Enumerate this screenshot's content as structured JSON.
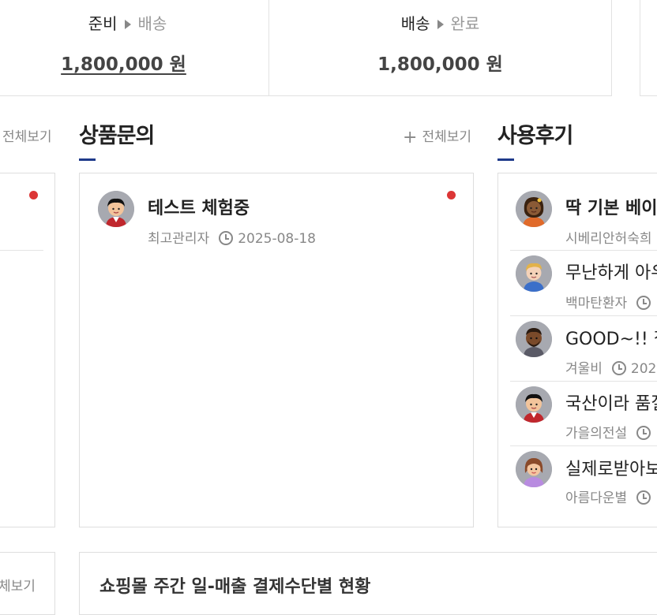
{
  "stats": [
    {
      "from": "준비",
      "to": "배송",
      "value": "1,800,000 원"
    },
    {
      "from": "배송",
      "to": "완료",
      "value": "1,800,000 원"
    }
  ],
  "left_section": {
    "view_all": "전체보기"
  },
  "inquiry": {
    "title": "상품문의",
    "view_all": "전체보기",
    "items": [
      {
        "title": "테스트 체험중",
        "author": "최고관리자",
        "date": "2025-08-18"
      }
    ]
  },
  "reviews": {
    "title": "사용후기",
    "items": [
      {
        "title": "딱 기본 베이",
        "author": "시베리안허숙희",
        "date": ""
      },
      {
        "title": "무난하게 아우",
        "author": "백마탄환자",
        "date": ""
      },
      {
        "title": "GOOD~!! 집",
        "author": "겨울비",
        "date": "202"
      },
      {
        "title": "국산이라 품질",
        "author": "가을의전설",
        "date": ""
      },
      {
        "title": "실제로받아보",
        "author": "아름다운별",
        "date": ""
      }
    ]
  },
  "bottom_left": {
    "view_all": "체보기"
  },
  "weekly_sales": {
    "title": "쇼핑몰 주간 일-매출 결제수단별 현황"
  },
  "colors": {
    "accent": "#1e3a8a",
    "badge": "#dc3636"
  }
}
